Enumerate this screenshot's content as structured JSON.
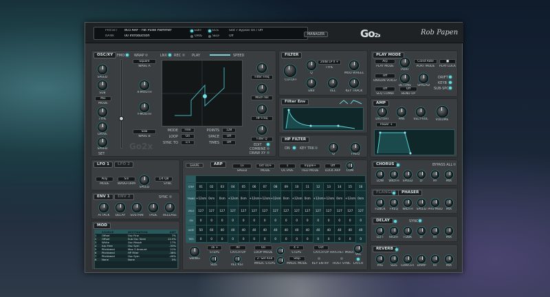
{
  "top": {
    "preset_label": "PRESET",
    "preset_value": "803 ARP - Fat Pulse Hammer",
    "bank_label": "BANK",
    "bank_value": "00 Introduction",
    "edit_label": "EDIT",
    "ecs_label": "ECS",
    "orig_label": "ORIG",
    "self_label": "SELF",
    "slot_label": "Slot 7 Bypass On / Off",
    "slot_value": "Off",
    "manager_label": "MANAGER",
    "logo": "Go2x",
    "signature": "Rob Papen"
  },
  "osc": {
    "title": "OSC/XY",
    "fm_label": "FMO",
    "wrap_label": "WRAP",
    "lnx_label": "LNX",
    "rec_label": "REC",
    "play_label": "PLAY",
    "speed_label": "SPEED",
    "wave_a_select": "Square",
    "wave_a_label": "WAVE A",
    "speed_knob": "SPEED",
    "sub_label": "SUB",
    "x_mouth_label": "X-MOUTH",
    "mix_select": "Mix",
    "mode_label": "MODE",
    "type_label": "TYPE",
    "y_mouth_label": "Y-MOUTH",
    "drive_label": "DRIVE",
    "wave_b_select": "Saw",
    "wave_b_label": "WAVE B",
    "speed2_label": "SPEED",
    "set_label": "SET",
    "logo_ghost": "Go2x",
    "xy_params": [
      {
        "label": "MODE",
        "value": "Free"
      },
      {
        "label": "LOOP",
        "value": "On"
      },
      {
        "label": "SYNC TO",
        "value": "1/1"
      }
    ],
    "xy_params2": [
      {
        "label": "POINTS",
        "value": "128"
      },
      {
        "label": "SPACE",
        "value": "Off"
      },
      {
        "label": "TIMES",
        "value": "Off"
      }
    ],
    "right_knobs": [
      "Filter Freq",
      "Mach Vol",
      "HP Freq",
      "Filter Q"
    ],
    "edit_label": "EDIT",
    "combine_label": "COMBINE",
    "draw_label": "DRAW XY"
  },
  "filter": {
    "title": "FILTER",
    "type_select": "24dB LP II +",
    "type_label": "TYPE",
    "q_label": "Q",
    "mod_label": "MOD WHEEL",
    "cutoff_label": "CUTOFF",
    "env_label": "ENV",
    "vel_label": "VEL",
    "keytrack_label": "KEY TRACK"
  },
  "filter_env": {
    "title": "Filter Env"
  },
  "hp_filter": {
    "title": "HP FILTER",
    "on_label": "ON",
    "keytrk_label": "KEY TRK",
    "q_label": "Q",
    "freq_label": "FREQ"
  },
  "play_mode": {
    "title": "PLAY MODE",
    "play_select": "Arp",
    "play_label": "PLAY MODE",
    "port_label": "PORT",
    "port_select": "Const Rate",
    "port_mode_label": "PORT MODE",
    "legato_label": "PLAY LOCK",
    "unison_select": "Off",
    "unison_label": "UNISON VOICES",
    "detune_label": "DETUNE",
    "spread_label": "SPREAD",
    "drift_label": "DRIFT",
    "keyb_label": "KEYB",
    "seq_select": "Off",
    "seq_label": "SEQ COMBI",
    "bend_label": "BEND UP",
    "bend_select": "Off",
    "subspec_label": "SUB-SPC"
  },
  "amp": {
    "title": "AMP",
    "distort_label": "DISTORT",
    "pan_label": "PAN",
    "velvol_label": "VEL>VOL",
    "volume_label": "VOLUME",
    "power_select": "Power +"
  },
  "lfo": {
    "title": "LFO 1",
    "title2": "LFO 2",
    "mode_select": "Poly",
    "mode_label": "MODE",
    "wave_select": "Sin",
    "wave_label": "WAVEFORM",
    "speed_label": "SPEED",
    "sync_select": "1/4 Q8",
    "sync_label": "SYNC"
  },
  "env": {
    "title": "ENV 1",
    "title2": "ENV 2",
    "sync_label": "SYNC",
    "labels": [
      "ATTACK",
      "DELAY",
      "SUSTAIN",
      "FADE",
      "RELEASE"
    ]
  },
  "mod": {
    "title": "MOD",
    "headers": [
      "",
      "SOURCE",
      "DESTINATION",
      "AMT"
    ],
    "rows": [
      [
        "1",
        "Offset",
        "Osc Fine",
        "7%"
      ],
      [
        "2",
        "Offset",
        "Sub Osc Semi",
        "12.5%"
      ],
      [
        "3",
        "White",
        "Osc Morph",
        "17%"
      ],
      [
        "4",
        "Arp Free",
        "Osc Sym",
        "-33%"
      ],
      [
        "5",
        "Pitchbend",
        "Max 3 Amount",
        "21%"
      ],
      [
        "6",
        "Pitchbend",
        "HP Filter",
        "-38%"
      ],
      [
        "7",
        "Pitchbend",
        "Osc Sym",
        "-49%"
      ],
      [
        "8",
        "None",
        "None",
        "0%"
      ]
    ]
  },
  "arp": {
    "title": "ARP",
    "shape_label": "SHAPE",
    "speed_select": "1x",
    "speed_label": "SPEED",
    "mode_select": "Oct UD+",
    "mode_label": "MODE",
    "octave_select": "1",
    "octave_label": "OCTAVE",
    "tiedmode_select": "Tripple+",
    "tiedmode_label": "TIED MODE",
    "lock_select": "Off",
    "lock_label": "LOCK ARP",
    "com_label": "COM",
    "row_labels": [
      "STEP",
      "TRANS",
      "VELO",
      "ON",
      "GATE",
      "TIES"
    ],
    "steps": [
      "01",
      "02",
      "03",
      "04",
      "05",
      "06",
      "07",
      "08",
      "09",
      "10",
      "11",
      "12",
      "13",
      "14",
      "15",
      "16"
    ],
    "trans": [
      "+12sm",
      "0sm",
      "0sm",
      "+12sm",
      "0sm",
      "+12sm",
      "+12sm",
      "+12sm",
      "0sm",
      "+12sm",
      "0sm",
      "+12sm",
      "+12sm",
      "0sm",
      "+12sm",
      "0sm"
    ],
    "velo": [
      "127",
      "127",
      "127",
      "127",
      "127",
      "127",
      "127",
      "127",
      "127",
      "127",
      "127",
      "127",
      "127",
      "127",
      "127",
      "127"
    ],
    "on": [
      "0",
      "0",
      "0",
      "0",
      "0",
      "0",
      "0",
      "0",
      "0",
      "0",
      "0",
      "0",
      "0",
      "0",
      "0",
      "0"
    ],
    "gate": [
      "50",
      "60",
      "40",
      "40",
      "40",
      "40",
      "40",
      "40",
      "40",
      "40",
      "40",
      "40",
      "40",
      "40",
      "40",
      "40"
    ],
    "ties": [
      "0",
      "0",
      "0",
      "0",
      "0",
      "0",
      "0",
      "0",
      "0",
      "0",
      "0",
      "0",
      "0",
      "0",
      "0",
      "0"
    ],
    "bottom": {
      "swing_label": "SWING",
      "steps_select": "16 +",
      "steps_label": "STEPS",
      "size_label": "SIZE",
      "catchup_select": "All",
      "catchup_label": "CATCH-UP",
      "velrst_label": "VEL RST",
      "loopmode_select": "On",
      "loopmode_label": "LOOP MODE",
      "magic_select": "2: Set Rnd",
      "magic_label": "MAGIC STEPS",
      "steps2_select": "4 +",
      "steps2_label": "STEPS",
      "magicmode_select": "Stop",
      "magicmode_label": "MAGIC MODE",
      "catchup2_select": "Oct",
      "catchup2_label": "CATCH-UP",
      "keyentry_label": "KEY ENTRY",
      "ratchet_label": "RATCHET MODE",
      "hostsync_label": "HOST SYNC",
      "vel_label": "VEL",
      "latch_label": "LATCH"
    }
  },
  "chorus": {
    "title": "CHORUS",
    "bypass_label": "BYPASS ALL",
    "labels": [
      "LOW",
      "WIDTH",
      "SPEED",
      "LF",
      "HF",
      "MIX"
    ]
  },
  "flanger": {
    "title": "FLANGER",
    "title2": "PHASER",
    "labels": [
      "FDBCK",
      "FREQ",
      "WIDTH",
      "SPEED",
      "PHS-MOD",
      "MIX"
    ]
  },
  "delay": {
    "title": "DELAY",
    "sync_label": "SYNC",
    "labels": [
      "LEFT",
      "RIGHT",
      "FDBK",
      "LF",
      "HF",
      "MIX"
    ]
  },
  "reverb": {
    "title": "REVERB",
    "labels": [
      "PRE",
      "SIZE",
      "LOWCUT",
      "DAMP",
      "HF",
      "MIX"
    ]
  }
}
